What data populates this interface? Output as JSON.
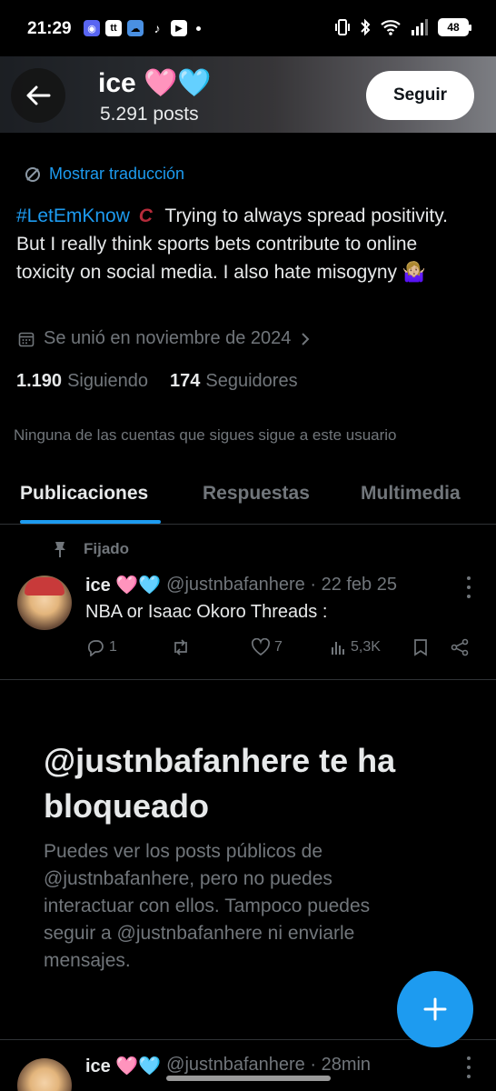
{
  "status_bar": {
    "time": "21:29",
    "battery": "48",
    "apps": [
      "discord-icon",
      "tt-icon",
      "weather-icon",
      "tiktok-icon",
      "youtube-icon"
    ]
  },
  "header": {
    "name": "ice 🩷🩵",
    "post_count": "5.291 posts",
    "follow_label": "Seguir"
  },
  "profile": {
    "translate_label": "Mostrar traducción",
    "bio_hashtag": "#LetEmKnow",
    "bio_text": "Trying to always spread positivity.  But I really think sports bets contribute to online toxicity on social media. I also hate misogyny 🤷🏼‍♀️",
    "joined": "Se unió en noviembre de 2024",
    "following_count": "1.190",
    "following_label": "Siguiendo",
    "followers_count": "174",
    "followers_label": "Seguidores",
    "mutuals_note": "Ninguna de las cuentas que sigues sigue a este usuario"
  },
  "tabs": [
    {
      "label": "Publicaciones",
      "active": true
    },
    {
      "label": "Respuestas",
      "active": false
    },
    {
      "label": "Multimedia",
      "active": false
    }
  ],
  "pinned_post": {
    "pinned_label": "Fijado",
    "author": "ice 🩷🩵",
    "handle_time": "@justnbafanhere · 22 feb 25",
    "text": "NBA or Isaac Okoro Threads :",
    "replies": "1",
    "reposts": "",
    "likes": "7",
    "views": "5,3K"
  },
  "blocked": {
    "title": "@justnbafanhere te ha bloqueado",
    "description": "Puedes ver los posts públicos de @justnbafanhere, pero no puedes interactuar con ellos. Tampoco puedes seguir a @justnbafanhere ni enviarle mensajes."
  },
  "next_post": {
    "author": "ice 🩷🩵",
    "handle_time": "@justnbafanhere · 28min"
  },
  "colors": {
    "accent": "#1d9bf0",
    "muted": "#71767b",
    "text": "#e7e9ea",
    "background": "#000000"
  }
}
